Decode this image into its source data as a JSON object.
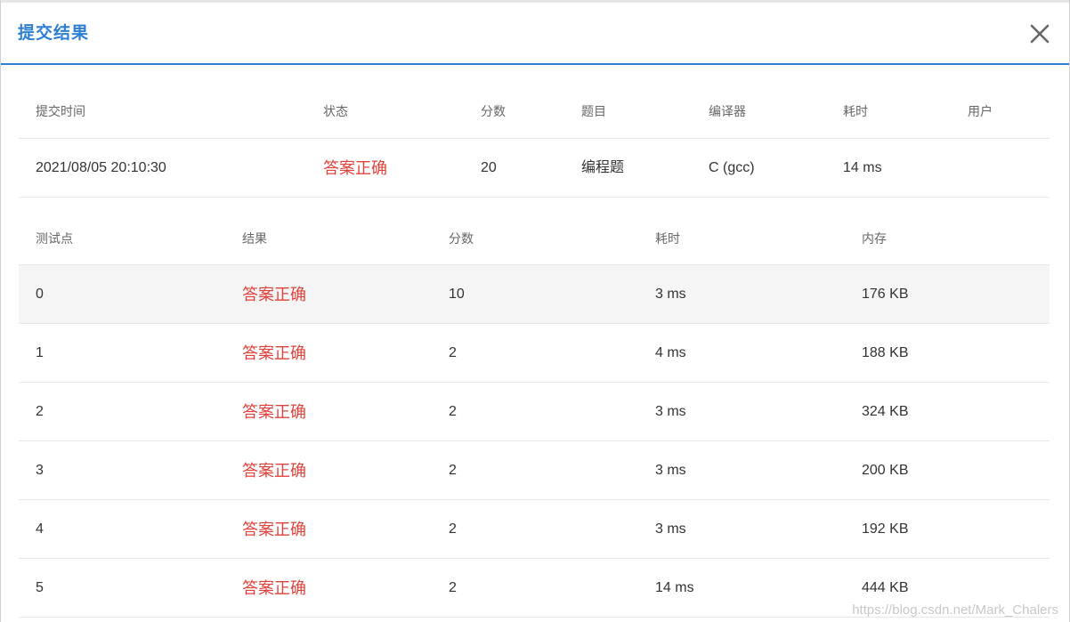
{
  "dialog": {
    "title": "提交结果",
    "close_icon": "close-icon"
  },
  "summary": {
    "headers": [
      "提交时间",
      "状态",
      "分数",
      "题目",
      "编译器",
      "耗时",
      "用户"
    ],
    "row": {
      "time": "2021/08/05 20:10:30",
      "status": "答案正确",
      "score": "20",
      "problem": "编程题",
      "compiler": "C (gcc)",
      "duration": "14 ms",
      "user": ""
    }
  },
  "cases": {
    "headers": [
      "测试点",
      "结果",
      "分数",
      "耗时",
      "内存"
    ],
    "rows": [
      {
        "id": "0",
        "result": "答案正确",
        "score": "10",
        "time": "3 ms",
        "memory": "176 KB"
      },
      {
        "id": "1",
        "result": "答案正确",
        "score": "2",
        "time": "4 ms",
        "memory": "188 KB"
      },
      {
        "id": "2",
        "result": "答案正确",
        "score": "2",
        "time": "3 ms",
        "memory": "324 KB"
      },
      {
        "id": "3",
        "result": "答案正确",
        "score": "2",
        "time": "3 ms",
        "memory": "200 KB"
      },
      {
        "id": "4",
        "result": "答案正确",
        "score": "2",
        "time": "3 ms",
        "memory": "192 KB"
      },
      {
        "id": "5",
        "result": "答案正确",
        "score": "2",
        "time": "14 ms",
        "memory": "444 KB"
      }
    ]
  },
  "colors": {
    "accent": "#2d7fd3",
    "success_text": "#e0423b",
    "highlight_row": "#f5f5f5"
  },
  "watermark": "https://blog.csdn.net/Mark_Chalers"
}
